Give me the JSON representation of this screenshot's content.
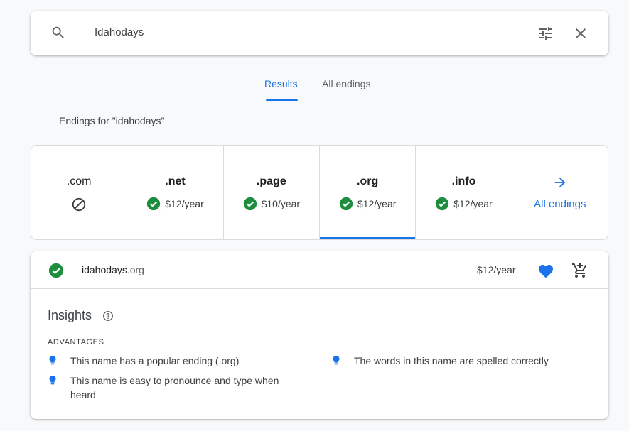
{
  "search": {
    "query": "Idahodays"
  },
  "tabs": [
    {
      "label": "Results"
    },
    {
      "label": "All endings"
    }
  ],
  "endings_heading": "Endings for \"idahodays\"",
  "endings": [
    {
      "tld": ".com",
      "available": false,
      "price": ""
    },
    {
      "tld": ".net",
      "available": true,
      "price": "$12/year"
    },
    {
      "tld": ".page",
      "available": true,
      "price": "$10/year"
    },
    {
      "tld": ".org",
      "available": true,
      "price": "$12/year",
      "selected": true
    },
    {
      "tld": ".info",
      "available": true,
      "price": "$12/year"
    }
  ],
  "all_endings_link": "All endings",
  "result": {
    "domain_name": "idahodays",
    "domain_tld": ".org",
    "price": "$12/year"
  },
  "insights": {
    "title": "Insights",
    "advantages_label": "ADVANTAGES",
    "items": [
      "This name has a popular ending (.org)",
      "This name is easy to pronounce and type when heard",
      "The words in this name are spelled correctly"
    ]
  },
  "colors": {
    "accent": "#1a73e8",
    "success": "#1e8e3e",
    "text": "#3c4043"
  }
}
